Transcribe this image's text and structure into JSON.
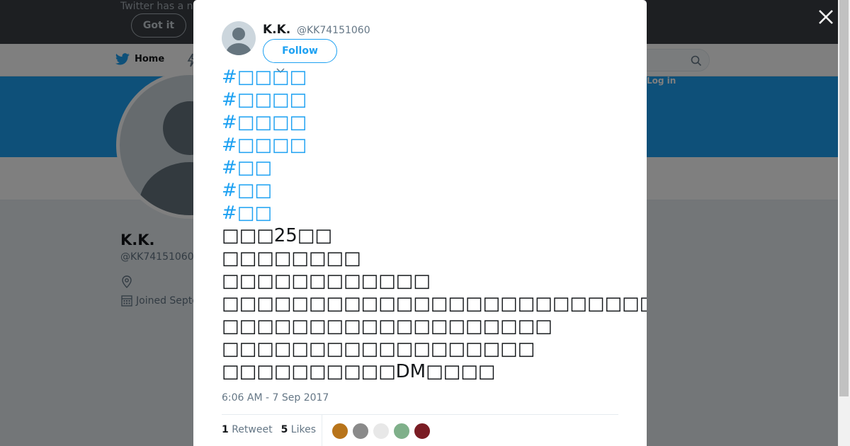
{
  "background": {
    "banner_text": "Twitter has a n",
    "got_it_label": "Got it",
    "home_label": "Home",
    "login_label": "Log in",
    "profile_name": "K.K.",
    "profile_handle": "@KK74151060",
    "joined_text": "Joined Septe"
  },
  "tweet": {
    "author_name": "K.K.",
    "author_handle": "@KK74151060",
    "follow_label": "Follow",
    "lines": [
      {
        "kind": "hashtag",
        "text": "#□□□□"
      },
      {
        "kind": "hashtag",
        "text": "#□□□□"
      },
      {
        "kind": "hashtag",
        "text": "#□□□□"
      },
      {
        "kind": "hashtag",
        "text": "#□□□□"
      },
      {
        "kind": "hashtag",
        "text": "#□□"
      },
      {
        "kind": "hashtag",
        "text": "#□□"
      },
      {
        "kind": "hashtag",
        "text": "#□□"
      },
      {
        "kind": "text",
        "text": "□□□25□□"
      },
      {
        "kind": "text",
        "text": "□□□□□□□□"
      },
      {
        "kind": "text",
        "text": "□□□□□□□□□□□□"
      },
      {
        "kind": "text",
        "text": "□□□□□□□□□□□□□□□□□□□□□□□□□□"
      },
      {
        "kind": "text",
        "text": "□□□□□□□□□□□□□□□□□□□"
      },
      {
        "kind": "text",
        "text": "□□□□□□□□□□□□□□□□□□"
      },
      {
        "kind": "text",
        "text": "□□□□□□□□□□DM□□□□"
      }
    ],
    "timestamp": "6:06 AM - 7 Sep 2017",
    "retweet_count": "1",
    "retweet_label": "Retweet",
    "like_count": "5",
    "like_label": "Likes"
  },
  "colors": {
    "accent": "#1da1f2",
    "liker_avatars": [
      "#b8741a",
      "#8a8a8a",
      "#e8e8e8",
      "#7fb08a",
      "#7a1c24"
    ]
  }
}
